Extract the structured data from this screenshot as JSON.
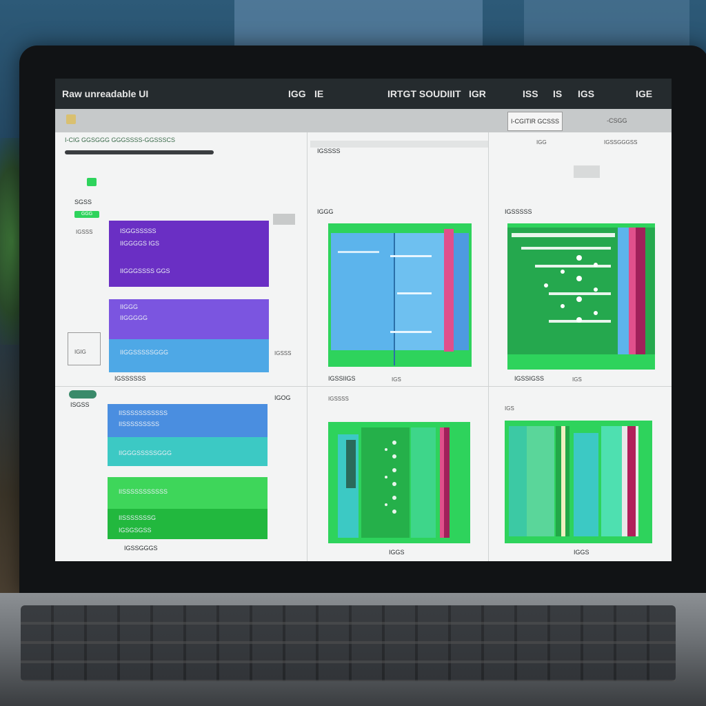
{
  "window": {
    "title": "Raw unreadable UI",
    "menu_left": [
      "IGG",
      "IE"
    ],
    "menu_center": "IRTGT SOUDIIIT",
    "menu_center_extra": "IGR",
    "menu_right": [
      "ISS",
      "IS",
      "IGS",
      "IGE"
    ]
  },
  "toolbar": {
    "button_label": "I-CGITIR GCSSS",
    "control_label": "-CSGG"
  },
  "panel_left_top": {
    "header": "I-CIG GGSGGG GGGSSSS-GGSSSCS",
    "section_label": "SGSS",
    "badge": "GGG",
    "side_label": "IGSSS",
    "foot_label": "IGSSSSSS",
    "corner_label": "IGIG"
  },
  "cards_top": [
    {
      "lines": [
        "ISGGSSSSS",
        "IIGGGGS IGS",
        "IIGGGSSSS GGS"
      ],
      "color": "#6a2fc4"
    },
    {
      "lines": [
        "IIGGG",
        "IIGGGGG",
        "IIGGSSSSSGGG"
      ],
      "colors": [
        "#7b55e0",
        "#4ea8e6"
      ]
    }
  ],
  "panel_left_bottom": {
    "header_label": "ISGSS",
    "corner_label": "IGOG",
    "foot_label": "IGSSGGGS"
  },
  "cards_bottom": [
    {
      "lines": [
        "IISSSSSSSSSSS",
        "IISSSSSSSSS",
        "IIGGGSSSSSGGG"
      ],
      "colors": [
        "#4a8ee0",
        "#3cc9c4"
      ]
    },
    {
      "lines": [
        "IISSSSSSSSSSS",
        "IISSSSSSSG",
        "IGSGSGSS"
      ],
      "colors": [
        "#3ed65a",
        "#22b83e"
      ]
    }
  ],
  "panels": [
    {
      "title": "IGSSSS",
      "sub": "IGGG",
      "foot": "IGSSIIGS",
      "foot2": "IGS"
    },
    {
      "title": "IGSSSSS",
      "sub": "IGG",
      "corner": "IGSSGGGSS",
      "foot": "IGSSIGSS",
      "foot2": "IGS"
    },
    {
      "title": "IGSSSS",
      "foot": "IGGS"
    },
    {
      "title": "IGS",
      "foot": "IGGS"
    }
  ],
  "colors": {
    "green": "#2ed35c",
    "blue": "#5cb4ec",
    "pink": "#e0508c",
    "purple": "#6a2fc4",
    "teal": "#3cc9c4"
  },
  "icons": [
    "folder-icon",
    "settings-icon"
  ]
}
